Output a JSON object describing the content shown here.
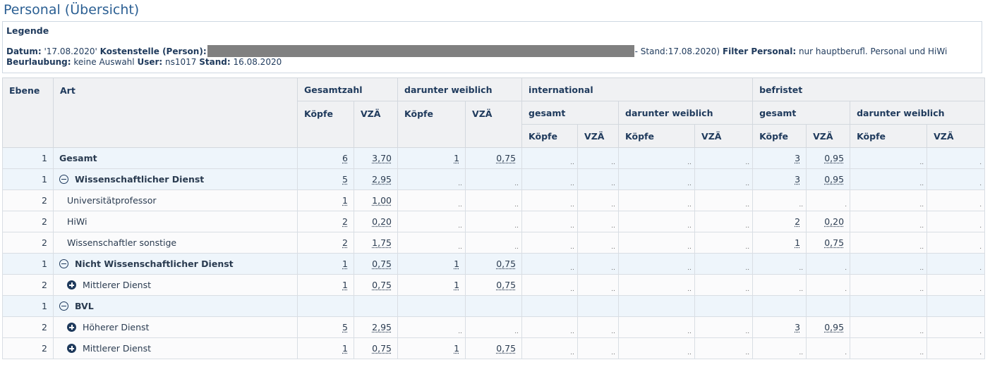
{
  "page": {
    "title": "Personal (Übersicht)"
  },
  "legend": {
    "title": "Legende",
    "datum_label": "Datum:",
    "datum_value": "'17.08.2020'",
    "kostenstelle_label": "Kostenstelle (Person):",
    "kostenstelle_suffix": "- Stand:17.08.2020)",
    "filter_label": "Filter Personal:",
    "filter_value": "nur hauptberufl. Personal und HiWi",
    "beurlaubung_label": "Beurlaubung:",
    "beurlaubung_value": "keine Auswahl",
    "user_label": "User:",
    "user_value": "ns1017",
    "stand_label": "Stand:",
    "stand_value": "16.08.2020"
  },
  "headers": {
    "ebene": "Ebene",
    "art": "Art",
    "gesamtzahl": "Gesamtzahl",
    "darunter_weiblich": "darunter weiblich",
    "international": "international",
    "befristet": "befristet",
    "gesamt": "gesamt",
    "koepfe": "Köpfe",
    "vza": "VZÄ"
  },
  "rows": [
    {
      "ebene": "1",
      "art": "Gesamt",
      "icon": "none",
      "level": 1,
      "cells": [
        "6",
        "3,70",
        "1",
        "0,75",
        "..",
        "..",
        "..",
        "..",
        "3",
        "0,95",
        "..",
        "."
      ]
    },
    {
      "ebene": "1",
      "art": "Wissenschaftlicher Dienst",
      "icon": "collapse",
      "level": 1,
      "cells": [
        "5",
        "2,95",
        "..",
        "..",
        "..",
        "..",
        "..",
        "..",
        "3",
        "0,95",
        "..",
        "."
      ]
    },
    {
      "ebene": "2",
      "art": "Universitätprofessor",
      "icon": "none",
      "level": 2,
      "cells": [
        "1",
        "1,00",
        "..",
        "..",
        "..",
        "..",
        "..",
        "..",
        "..",
        ".",
        "..",
        "."
      ]
    },
    {
      "ebene": "2",
      "art": "HiWi",
      "icon": "none",
      "level": 2,
      "cells": [
        "2",
        "0,20",
        "..",
        "..",
        "..",
        "..",
        "..",
        "..",
        "2",
        "0,20",
        "..",
        "."
      ]
    },
    {
      "ebene": "2",
      "art": "Wissenschaftler sonstige",
      "icon": "none",
      "level": 2,
      "cells": [
        "2",
        "1,75",
        "..",
        "..",
        "..",
        "..",
        "..",
        "..",
        "1",
        "0,75",
        "..",
        "."
      ]
    },
    {
      "ebene": "1",
      "art": "Nicht Wissenschaftlicher Dienst",
      "icon": "collapse",
      "level": 1,
      "cells": [
        "1",
        "0,75",
        "1",
        "0,75",
        "..",
        "..",
        "..",
        "..",
        "..",
        ".",
        "..",
        "."
      ]
    },
    {
      "ebene": "2",
      "art": "Mittlerer Dienst",
      "icon": "expand",
      "level": 2,
      "cells": [
        "1",
        "0,75",
        "1",
        "0,75",
        "..",
        "..",
        "..",
        "..",
        "..",
        ".",
        "..",
        "."
      ]
    },
    {
      "ebene": "1",
      "art": "BVL",
      "icon": "collapse",
      "level": 1,
      "cells": [
        "",
        "",
        "",
        "",
        "",
        "",
        "",
        "",
        "",
        "",
        "",
        ""
      ]
    },
    {
      "ebene": "2",
      "art": "Höherer Dienst",
      "icon": "expand",
      "level": 2,
      "cells": [
        "5",
        "2,95",
        "..",
        "..",
        "..",
        "..",
        "..",
        "..",
        "3",
        "0,95",
        "..",
        "."
      ]
    },
    {
      "ebene": "2",
      "art": "Mittlerer Dienst",
      "icon": "expand",
      "level": 2,
      "cells": [
        "1",
        "0,75",
        "1",
        "0,75",
        "..",
        "..",
        "..",
        "..",
        "..",
        ".",
        "..",
        "."
      ]
    }
  ]
}
